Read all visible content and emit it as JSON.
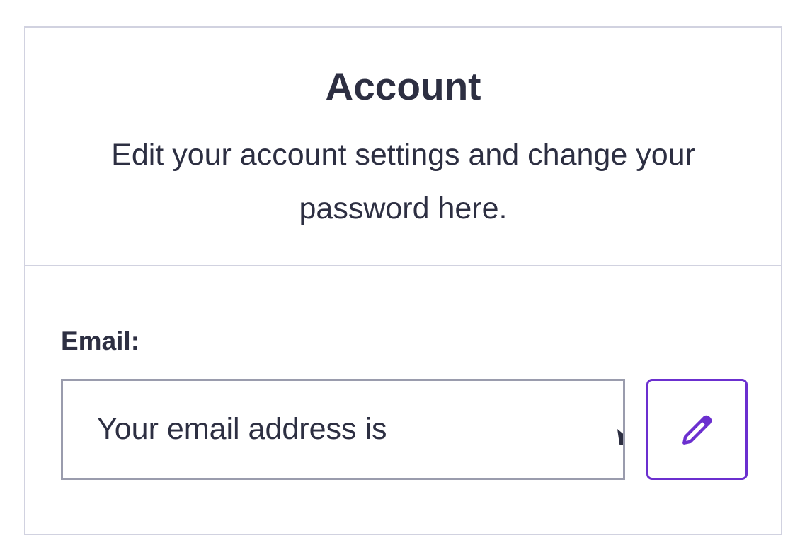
{
  "account": {
    "title": "Account",
    "subtitle": "Edit your account settings and change your password here."
  },
  "email": {
    "label": "Email:",
    "value": "Your email address is"
  },
  "edit_button": {
    "icon": "pencil-icon",
    "color": "#6b2fcf"
  },
  "colors": {
    "text": "#2d2f42",
    "border": "#d1d2e0",
    "input_border": "#9a9cad",
    "accent": "#6b2fcf"
  }
}
